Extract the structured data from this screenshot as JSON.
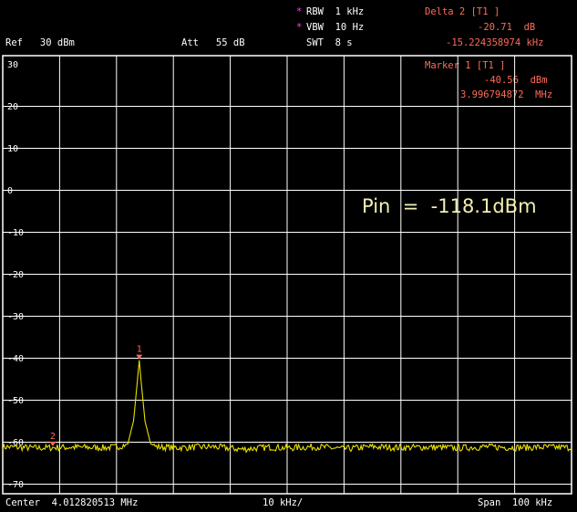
{
  "header": {
    "rbw_star": "*",
    "rbw": "RBW  1 kHz",
    "vbw_star": "*",
    "vbw": "VBW  10 Hz",
    "swt": "SWT  8 s",
    "ref": "Ref   30 dBm",
    "att": "Att   55 dB",
    "delta_title": "Delta 2 [T1 ]",
    "delta_level": "-20.71  dB",
    "delta_freq": "-15.224358974 kHz",
    "marker_title": "Marker 1 [T1 ]",
    "marker_level": "-40.56  dBm",
    "marker_freq": "3.996794872  MHz"
  },
  "footer": {
    "center": "Center  4.012820513 MHz",
    "div": "10 kHz/",
    "span": "Span  100 kHz"
  },
  "annotation": "Pin  =  -118.1dBm",
  "colors": {
    "trace": "#e8e000",
    "grid": "#ffffff",
    "marker": "#ff6b5a",
    "annotation": "#f2f0b0"
  },
  "chart_data": {
    "type": "line",
    "ylim": [
      -70,
      30
    ],
    "xlim": [
      -50,
      50
    ],
    "y_ticks": [
      "30",
      "20",
      "10",
      "0",
      "-10",
      "-20",
      "-30",
      "-40",
      "-50",
      "-60",
      "-70"
    ],
    "y_tick_values": [
      30,
      20,
      10,
      0,
      -10,
      -20,
      -30,
      -40,
      -50,
      -60,
      -70
    ],
    "x_ticks": [
      -50,
      -40,
      -30,
      -20,
      -10,
      0,
      10,
      20,
      30,
      40,
      50
    ],
    "grid": true,
    "noise_floor": -61.3,
    "series": [
      {
        "x": [
          -50,
          -44,
          -38,
          -32,
          -30,
          -28,
          -27,
          -26.5,
          -26,
          -25.5,
          -25,
          -24,
          -23,
          -22,
          -19,
          -13,
          -8,
          -3,
          0,
          5,
          10,
          15,
          20,
          25,
          30,
          35,
          40,
          45,
          50
        ],
        "y": [
          -61.2,
          -61.5,
          -61.3,
          -61.4,
          -61.3,
          -60.5,
          -55,
          -48,
          -40.6,
          -48,
          -55,
          -60.5,
          -61.2,
          -61.3,
          -61.4,
          -61.2,
          -61.8,
          -61.3,
          -61.5,
          -61.2,
          -61.7,
          -61.2,
          -61.4,
          -61.3,
          -61.5,
          -61.2,
          -61.4,
          -61.3,
          -61.4
        ]
      }
    ],
    "markers": [
      {
        "label": "1",
        "x": -26,
        "y": -40.56
      },
      {
        "label": "2",
        "x": -41.2,
        "y": -61.27
      }
    ]
  }
}
